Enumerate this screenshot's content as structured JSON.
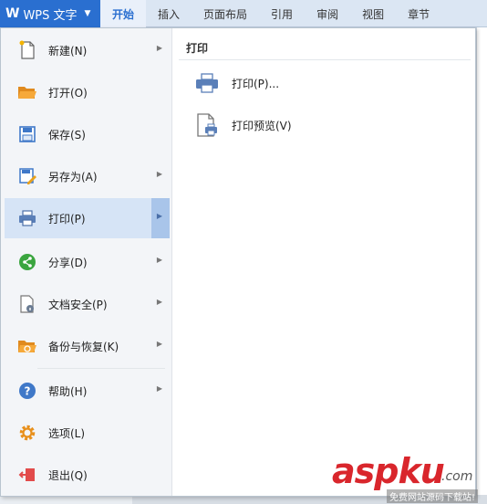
{
  "app": {
    "name": "WPS 文字",
    "logo": "W"
  },
  "ribbon": {
    "tabs": [
      {
        "label": "开始",
        "active": true
      },
      {
        "label": "插入"
      },
      {
        "label": "页面布局"
      },
      {
        "label": "引用"
      },
      {
        "label": "审阅"
      },
      {
        "label": "视图"
      },
      {
        "label": "章节"
      }
    ]
  },
  "menu": {
    "items": [
      {
        "label": "新建(N)",
        "icon": "new-document-icon",
        "arrow": true
      },
      {
        "label": "打开(O)",
        "icon": "folder-open-icon",
        "arrow": false
      },
      {
        "label": "保存(S)",
        "icon": "save-icon",
        "arrow": false
      },
      {
        "label": "另存为(A)",
        "icon": "save-as-icon",
        "arrow": true
      },
      {
        "label": "打印(P)",
        "icon": "printer-icon",
        "arrow": true,
        "selected": true
      },
      {
        "label": "分享(D)",
        "icon": "share-icon",
        "arrow": true
      },
      {
        "label": "文档安全(P)",
        "icon": "document-security-icon",
        "arrow": true
      },
      {
        "label": "备份与恢复(K)",
        "icon": "backup-restore-icon",
        "arrow": true
      },
      {
        "label": "帮助(H)",
        "icon": "help-icon",
        "arrow": true
      },
      {
        "label": "选项(L)",
        "icon": "gear-icon",
        "arrow": false
      },
      {
        "label": "退出(Q)",
        "icon": "exit-icon",
        "arrow": false
      }
    ]
  },
  "submenu": {
    "title": "打印",
    "items": [
      {
        "label": "打印(P)...",
        "icon": "printer-icon"
      },
      {
        "label": "打印预览(V)",
        "icon": "print-preview-icon"
      }
    ]
  },
  "watermark": {
    "brand_a": "asp",
    "brand_b": "ku",
    "tld": ".com",
    "tagline": "免费网站源码下载站!"
  },
  "colors": {
    "accent": "#2a6fd0",
    "selected_bg": "#d6e4f6"
  }
}
